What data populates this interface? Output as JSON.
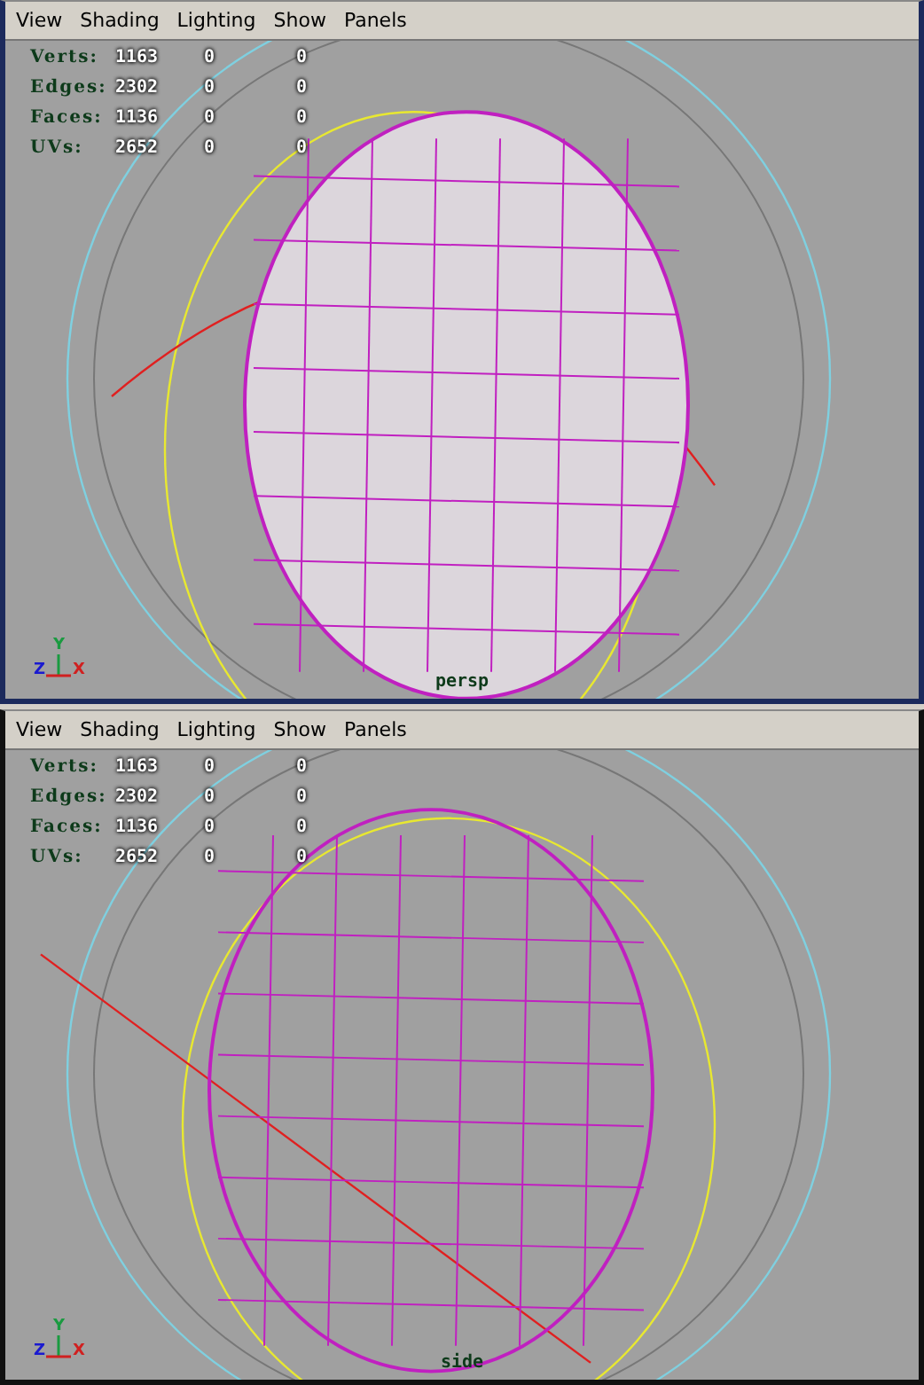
{
  "panels": [
    {
      "active": true,
      "menu": [
        "View",
        "Shading",
        "Lighting",
        "Show",
        "Panels"
      ],
      "stats": [
        {
          "label": "Verts:",
          "values": [
            "1163",
            "0",
            "0"
          ]
        },
        {
          "label": "Edges:",
          "values": [
            "2302",
            "0",
            "0"
          ]
        },
        {
          "label": "Faces:",
          "values": [
            "1136",
            "0",
            "0"
          ]
        },
        {
          "label": "UVs:",
          "values": [
            "2652",
            "0",
            "0"
          ]
        }
      ],
      "axes": {
        "y": "Y",
        "z": "Z",
        "x": "X"
      },
      "camera_label": "persp"
    },
    {
      "active": false,
      "menu": [
        "View",
        "Shading",
        "Lighting",
        "Show",
        "Panels"
      ],
      "stats": [
        {
          "label": "Verts:",
          "values": [
            "1163",
            "0",
            "0"
          ]
        },
        {
          "label": "Edges:",
          "values": [
            "2302",
            "0",
            "0"
          ]
        },
        {
          "label": "Faces:",
          "values": [
            "1136",
            "0",
            "0"
          ]
        },
        {
          "label": "UVs:",
          "values": [
            "2652",
            "0",
            "0"
          ]
        }
      ],
      "axes": {
        "y": "Y",
        "z": "Z",
        "x": "X"
      },
      "camera_label": "side"
    }
  ]
}
